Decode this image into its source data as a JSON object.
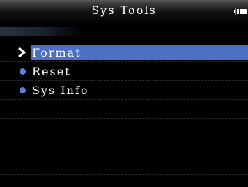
{
  "header": {
    "title": "Sys Tools",
    "battery_icon": "battery-full-icon"
  },
  "menu": {
    "items": [
      {
        "label": "Format",
        "marker": "chevron-right-icon",
        "selected": true
      },
      {
        "label": "Reset",
        "marker": "bullet-dot-icon",
        "selected": false
      },
      {
        "label": "Sys Info",
        "marker": "bullet-dot-icon",
        "selected": false
      }
    ]
  },
  "colors": {
    "selection": "#4d6fc4",
    "bullet": "#5f7fd0",
    "background": "#000000",
    "text": "#ffffff"
  }
}
